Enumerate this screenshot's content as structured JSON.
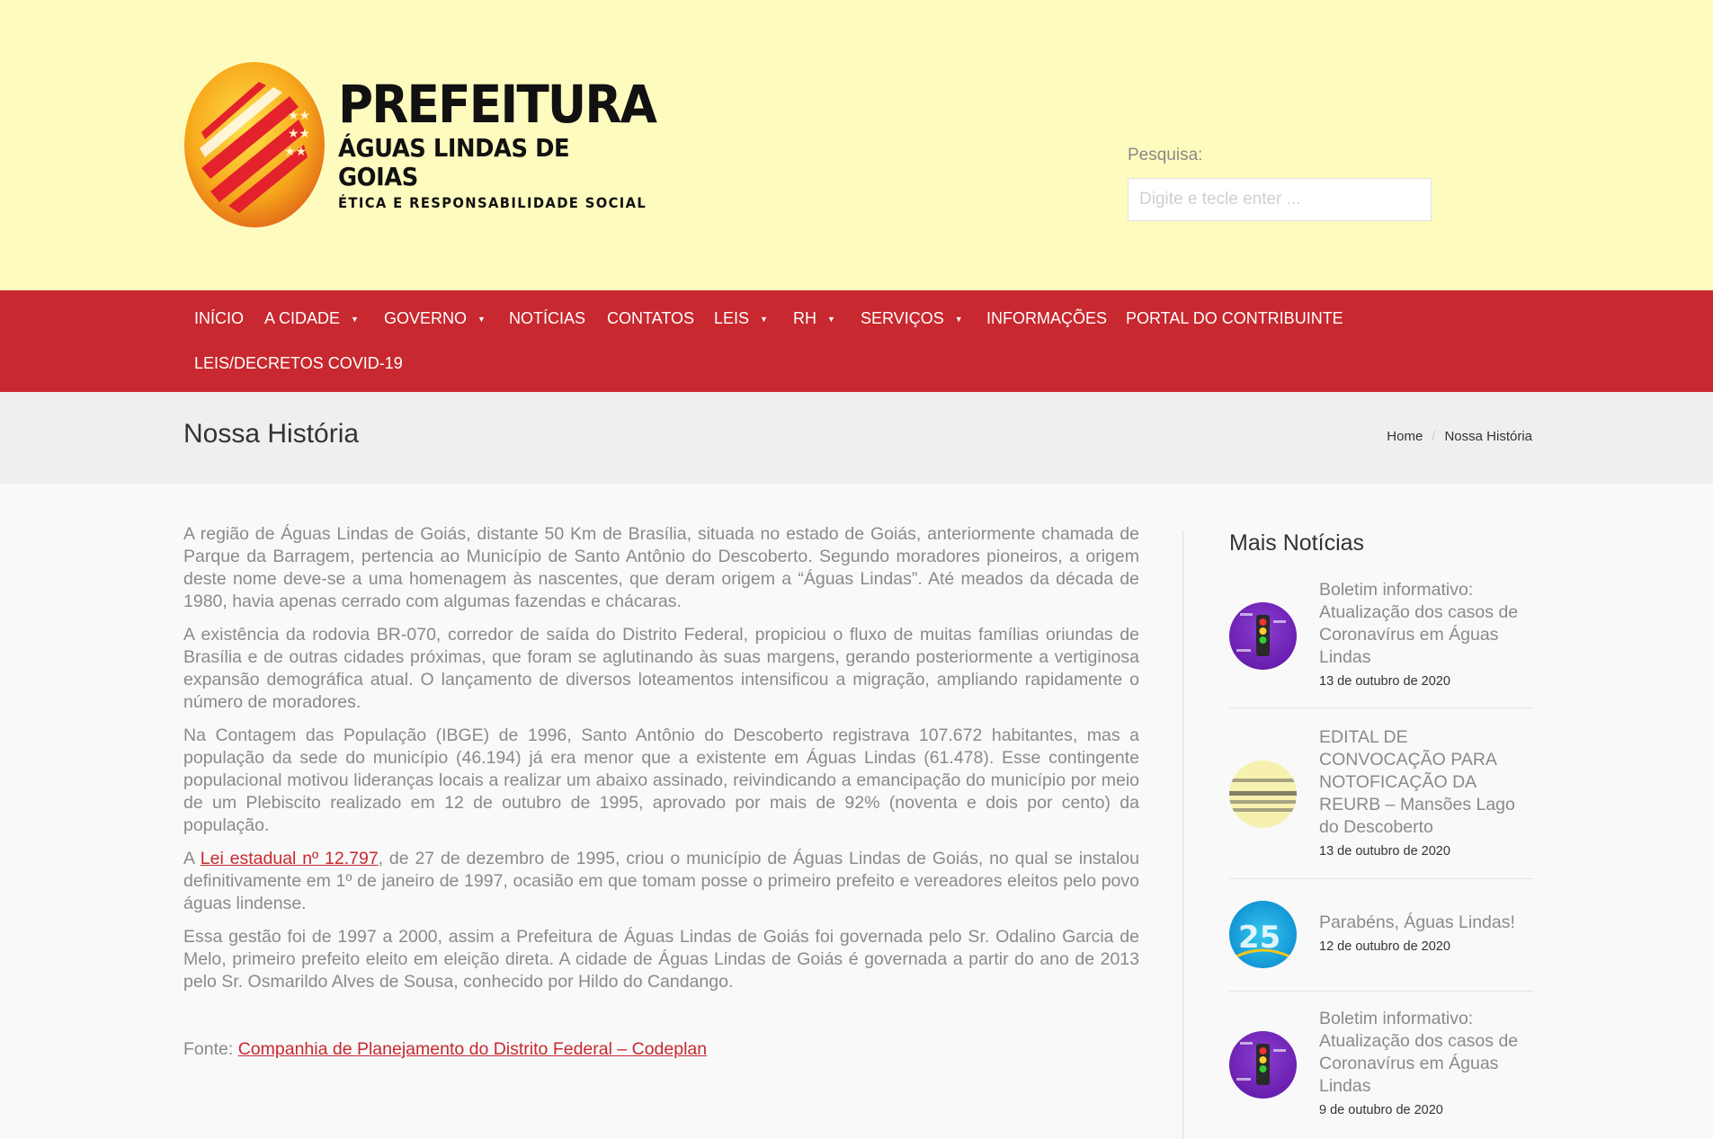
{
  "header": {
    "logo": {
      "title": "PREFEITURA",
      "subtitle": "ÁGUAS LINDAS DE GOIAS",
      "tagline": "ÉTICA E RESPONSABILIDADE SOCIAL"
    },
    "search": {
      "label": "Pesquisa:",
      "placeholder": "Digite e tecle enter ..."
    }
  },
  "nav": {
    "items": [
      {
        "label": "INÍCIO",
        "has_dropdown": false
      },
      {
        "label": "A CIDADE",
        "has_dropdown": true
      },
      {
        "label": "GOVERNO",
        "has_dropdown": true
      },
      {
        "label": "NOTÍCIAS",
        "has_dropdown": false
      },
      {
        "label": "CONTATOS",
        "has_dropdown": false
      },
      {
        "label": "LEIS",
        "has_dropdown": true
      },
      {
        "label": "RH",
        "has_dropdown": true
      },
      {
        "label": "SERVIÇOS",
        "has_dropdown": true
      },
      {
        "label": "INFORMAÇÕES",
        "has_dropdown": false
      },
      {
        "label": "PORTAL DO CONTRIBUINTE",
        "has_dropdown": false
      },
      {
        "label": "LEIS/DECRETOS COVID-19",
        "has_dropdown": false
      }
    ],
    "caret": "▼"
  },
  "page": {
    "title": "Nossa História",
    "breadcrumb": {
      "home": "Home",
      "separator": "/",
      "current": "Nossa História"
    }
  },
  "content": {
    "p1": "A região de Águas Lindas de Goiás, distante 50 Km de Brasília, situada no estado de Goiás, anteriormente chamada de Parque da Barragem, pertencia ao Município de Santo Antônio do Descoberto. Segundo moradores pioneiros, a origem deste nome deve-se a uma homenagem às nascentes, que deram origem a “Águas Lindas”. Até meados da década de 1980, havia apenas cerrado com algumas fazendas e chácaras.",
    "p2": "A existência da rodovia BR-070, corredor de saída do Distrito Federal, propiciou o fluxo de muitas famílias oriundas de Brasília e de outras cidades próximas, que foram se aglutinando às suas margens, gerando posteriormente a vertiginosa expansão demográfica atual. O lançamento de diversos loteamentos intensificou a migração, ampliando rapidamente o número de moradores.",
    "p3": "Na Contagem das População (IBGE) de 1996, Santo Antônio do Descoberto registrava 107.672 habitantes, mas a população da sede do município (46.194) já era menor que a existente em Águas Lindas (61.478). Esse contingente populacional motivou lideranças locais a realizar um abaixo assinado, reivindicando a emancipação do município por meio de um Plebiscito realizado em 12 de outubro de 1995, aprovado por mais de 92% (noventa e dois por cento) da população.",
    "p4_prefix": "A ",
    "p4_link": "Lei estadual nº 12.797",
    "p4_suffix": ", de 27 de dezembro de 1995, criou o município de Águas Lindas de Goiás, no qual se instalou definitivamente em 1º de janeiro de 1997, ocasião em que tomam posse o primeiro prefeito e vereadores eleitos pelo povo águas lindense.",
    "p5": "Essa gestão foi de 1997 a 2000, assim a Prefeitura de Águas Lindas de Goiás foi governada pelo Sr. Odalino Garcia de Melo, primeiro prefeito eleito em eleição direta. A cidade de Águas Lindas de Goiás é governada a partir do ano de 2013 pelo Sr. Osmarildo Alves de Sousa, conhecido por Hildo do Candango.",
    "source_prefix": "Fonte: ",
    "source_link": "Companhia de Planejamento do Distrito Federal – Codeplan"
  },
  "sidebar": {
    "title": "Mais Notícias",
    "news": [
      {
        "title": "Boletim informativo: Atualização dos casos de Coronavírus em Águas Lindas",
        "date": "13 de outubro de 2020",
        "thumb": "purple"
      },
      {
        "title": "EDITAL DE CONVOCAÇÃO PARA NOTOFICAÇÃO DA REURB – Mansões Lago do Descoberto",
        "date": "13 de outubro de 2020",
        "thumb": "yellow"
      },
      {
        "title": "Parabéns, Águas Lindas!",
        "date": "12 de outubro de 2020",
        "thumb": "blue"
      },
      {
        "title": "Boletim informativo: Atualização dos casos de Coronavírus em Águas Lindas",
        "date": "9 de outubro de 2020",
        "thumb": "purple"
      }
    ]
  },
  "colors": {
    "header_bg": "#fefbbe",
    "nav_bg": "#c8282f",
    "link": "#c8282f",
    "titlebar_bg": "#efefef"
  }
}
